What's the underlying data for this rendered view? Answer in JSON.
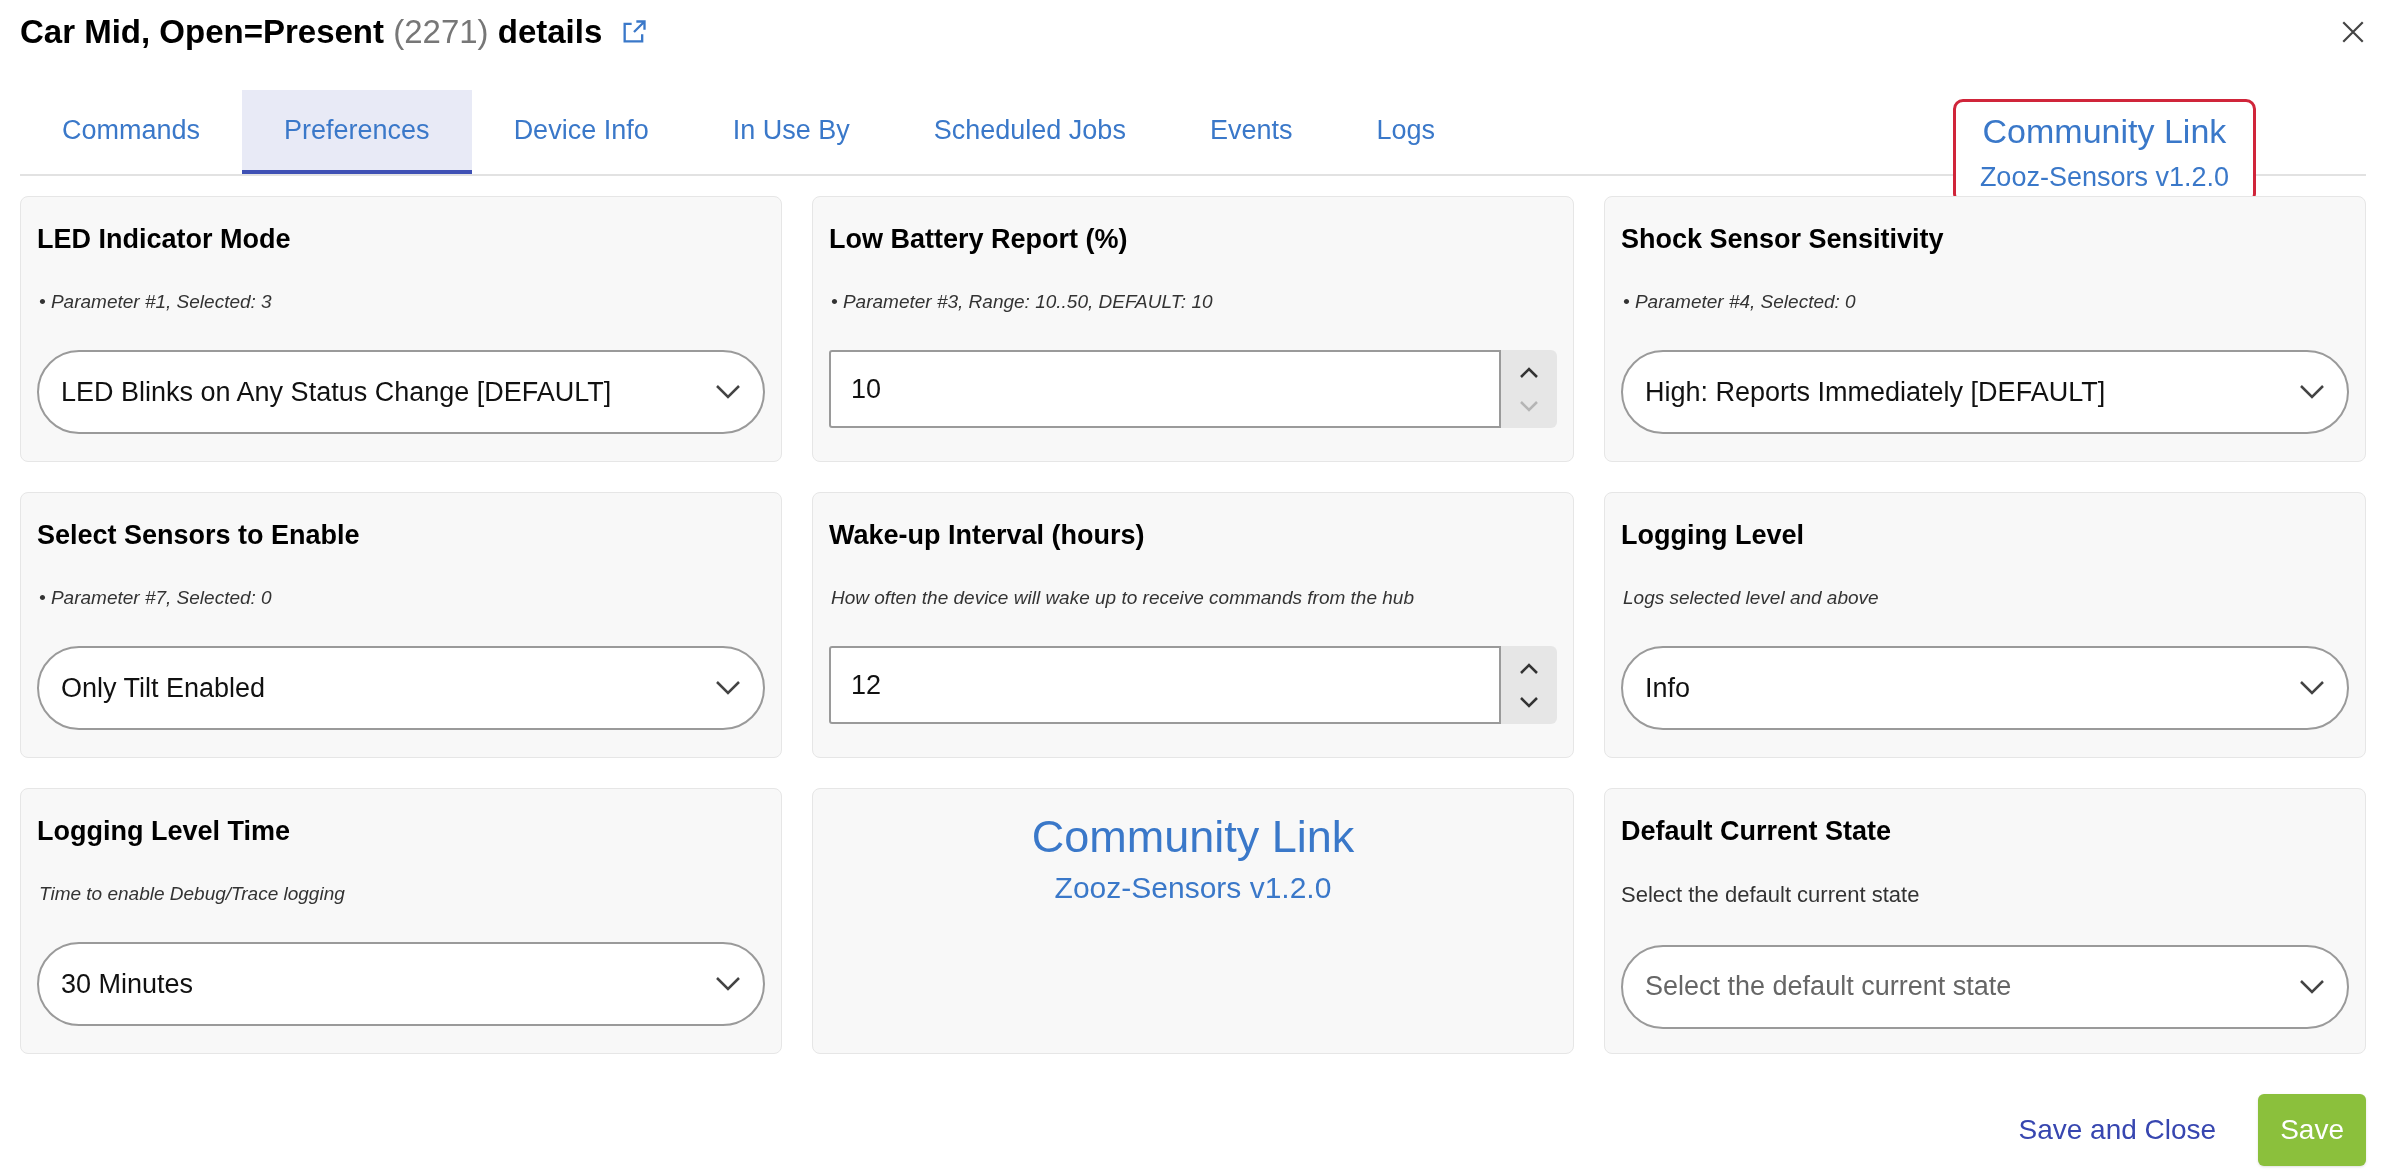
{
  "dialog": {
    "title": {
      "name": "Car Mid, Open=Present",
      "id": "(2271)",
      "suffix": "details"
    }
  },
  "tabs": [
    {
      "label": "Commands",
      "selected": false
    },
    {
      "label": "Preferences",
      "selected": true
    },
    {
      "label": "Device Info",
      "selected": false
    },
    {
      "label": "In Use By",
      "selected": false
    },
    {
      "label": "Scheduled Jobs",
      "selected": false
    },
    {
      "label": "Events",
      "selected": false
    },
    {
      "label": "Logs",
      "selected": false
    }
  ],
  "header_link": {
    "title": "Community Link",
    "version": "Zooz-Sensors v1.2.0"
  },
  "preferences": [
    {
      "kind": "select",
      "title": "LED Indicator Mode",
      "help": "• Parameter #1, Selected: 3",
      "help_italic": true,
      "value": "LED Blinks on Any Status Change [DEFAULT]"
    },
    {
      "kind": "number",
      "title": "Low Battery Report (%)",
      "help": "• Parameter #3, Range: 10..50, DEFAULT: 10",
      "help_italic": true,
      "value": "10",
      "down_disabled": true
    },
    {
      "kind": "select",
      "title": "Shock Sensor Sensitivity",
      "help": "• Parameter #4, Selected: 0",
      "help_italic": true,
      "value": "High: Reports Immediately [DEFAULT]"
    },
    {
      "kind": "select",
      "title": "Select Sensors to Enable",
      "help": "• Parameter #7, Selected: 0",
      "help_italic": true,
      "value": "Only Tilt Enabled"
    },
    {
      "kind": "number",
      "title": "Wake-up Interval (hours)",
      "help": "How often the device will wake up to receive commands from the hub",
      "help_italic": true,
      "value": "12",
      "down_disabled": false
    },
    {
      "kind": "select",
      "title": "Logging Level",
      "help": "Logs selected level and above",
      "help_italic": true,
      "value": "Info"
    },
    {
      "kind": "select",
      "title": "Logging Level Time",
      "help": "Time to enable Debug/Trace logging",
      "help_italic": true,
      "value": "30 Minutes"
    },
    {
      "kind": "link",
      "title": "Community Link",
      "version": "Zooz-Sensors v1.2.0"
    },
    {
      "kind": "select",
      "title": "Default Current State",
      "help": "Select the default current state",
      "help_italic": false,
      "placeholder": "Select the default current state"
    }
  ],
  "footer": {
    "buttons": [
      {
        "label": "Save and Close",
        "kind": "text"
      },
      {
        "label": "Save",
        "kind": "primary"
      }
    ]
  }
}
